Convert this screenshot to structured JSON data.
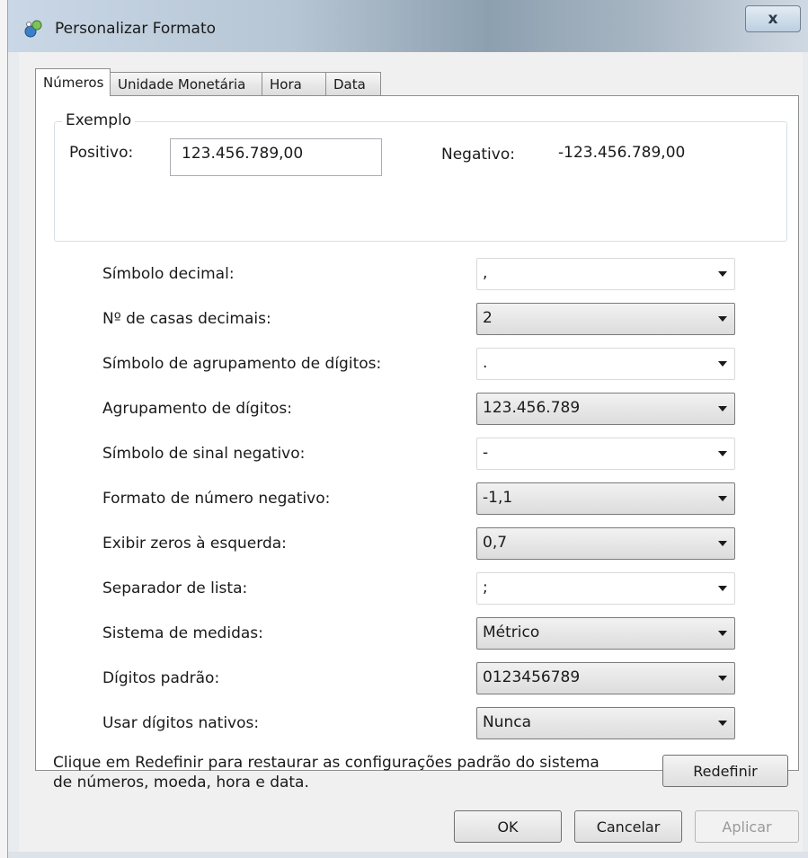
{
  "window": {
    "title": "Personalizar Formato",
    "close_label": "x"
  },
  "tabs": [
    {
      "label": "Números",
      "active": true
    },
    {
      "label": "Unidade Monetária",
      "active": false
    },
    {
      "label": "Hora",
      "active": false
    },
    {
      "label": "Data",
      "active": false
    }
  ],
  "example": {
    "legend": "Exemplo",
    "positive_label": "Positivo:",
    "positive_value": "123.456.789,00",
    "negative_label": "Negativo:",
    "negative_value": "-123.456.789,00"
  },
  "settings": [
    {
      "label": "Símbolo decimal:",
      "value": ",",
      "style": "dropdown"
    },
    {
      "label": "Nº de casas decimais:",
      "value": "2",
      "style": "editable"
    },
    {
      "label": "Símbolo de agrupamento de dígitos:",
      "value": ".",
      "style": "dropdown"
    },
    {
      "label": "Agrupamento de dígitos:",
      "value": "123.456.789",
      "style": "editable"
    },
    {
      "label": "Símbolo de sinal negativo:",
      "value": "-",
      "style": "dropdown"
    },
    {
      "label": "Formato de número negativo:",
      "value": "-1,1",
      "style": "editable"
    },
    {
      "label": "Exibir zeros à esquerda:",
      "value": "0,7",
      "style": "editable"
    },
    {
      "label": "Separador de lista:",
      "value": ";",
      "style": "dropdown"
    },
    {
      "label": "Sistema de medidas:",
      "value": "Métrico",
      "style": "editable"
    },
    {
      "label": "Dígitos padrão:",
      "value": "0123456789",
      "style": "editable"
    },
    {
      "label": "Usar dígitos nativos:",
      "value": "Nunca",
      "style": "editable"
    }
  ],
  "info": {
    "line1": "Clique em Redefinir para restaurar as configurações padrão do sistema",
    "line2": "de números, moeda, hora e data."
  },
  "buttons": {
    "reset": "Redefinir",
    "ok": "OK",
    "cancel": "Cancelar",
    "apply": "Aplicar"
  },
  "icons": {
    "app": "regional-settings-icon",
    "dropdown": "chevron-down-icon"
  }
}
